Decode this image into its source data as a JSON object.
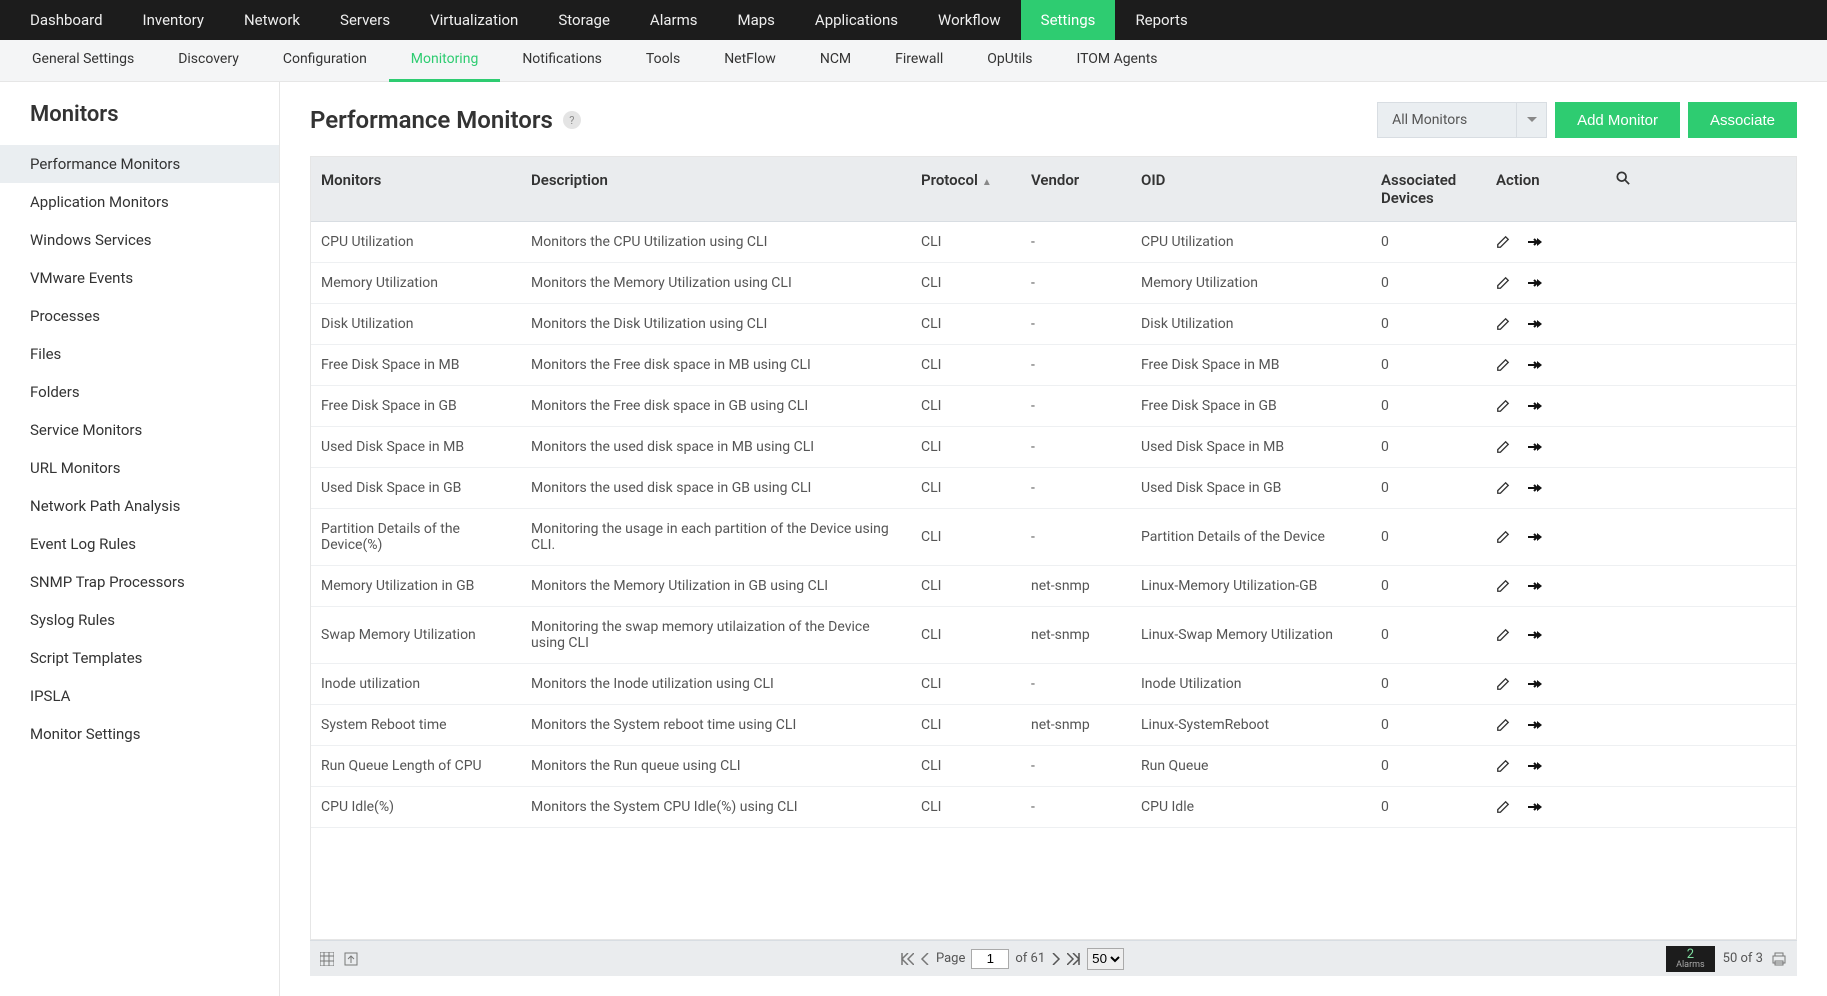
{
  "topnav": [
    "Dashboard",
    "Inventory",
    "Network",
    "Servers",
    "Virtualization",
    "Storage",
    "Alarms",
    "Maps",
    "Applications",
    "Workflow",
    "Settings",
    "Reports"
  ],
  "topnav_active": 10,
  "subnav": [
    "General Settings",
    "Discovery",
    "Configuration",
    "Monitoring",
    "Notifications",
    "Tools",
    "NetFlow",
    "NCM",
    "Firewall",
    "OpUtils",
    "ITOM Agents"
  ],
  "subnav_active": 3,
  "sidebar": {
    "title": "Monitors",
    "items": [
      "Performance Monitors",
      "Application Monitors",
      "Windows Services",
      "VMware Events",
      "Processes",
      "Files",
      "Folders",
      "Service Monitors",
      "URL Monitors",
      "Network Path Analysis",
      "Event Log Rules",
      "SNMP Trap Processors",
      "Syslog Rules",
      "Script Templates",
      "IPSLA",
      "Monitor Settings"
    ],
    "active": 0
  },
  "page": {
    "title": "Performance Monitors",
    "filter_label": "All Monitors",
    "add_btn": "Add Monitor",
    "associate_btn": "Associate"
  },
  "table": {
    "headers": {
      "monitors": "Monitors",
      "description": "Description",
      "protocol": "Protocol",
      "vendor": "Vendor",
      "oid": "OID",
      "associated": "Associated Devices",
      "action": "Action"
    },
    "rows": [
      {
        "m": "CPU Utilization",
        "d": "Monitors the CPU Utilization using CLI",
        "p": "CLI",
        "v": "-",
        "o": "CPU Utilization",
        "a": "0"
      },
      {
        "m": "Memory Utilization",
        "d": "Monitors the Memory Utilization using CLI",
        "p": "CLI",
        "v": "-",
        "o": "Memory Utilization",
        "a": "0"
      },
      {
        "m": "Disk Utilization",
        "d": "Monitors the Disk Utilization using CLI",
        "p": "CLI",
        "v": "-",
        "o": "Disk Utilization",
        "a": "0"
      },
      {
        "m": "Free Disk Space in MB",
        "d": "Monitors the Free disk space in MB using CLI",
        "p": "CLI",
        "v": "-",
        "o": "Free Disk Space in MB",
        "a": "0"
      },
      {
        "m": "Free Disk Space in GB",
        "d": "Monitors the Free disk space in GB using CLI",
        "p": "CLI",
        "v": "-",
        "o": "Free Disk Space in GB",
        "a": "0"
      },
      {
        "m": "Used Disk Space in MB",
        "d": "Monitors the used disk space in MB using CLI",
        "p": "CLI",
        "v": "-",
        "o": "Used Disk Space in MB",
        "a": "0"
      },
      {
        "m": "Used Disk Space in GB",
        "d": "Monitors the used disk space in GB using CLI",
        "p": "CLI",
        "v": "-",
        "o": "Used Disk Space in GB",
        "a": "0"
      },
      {
        "m": "Partition Details of the Device(%)",
        "d": "Monitoring the usage in each partition of the Device using CLI.",
        "p": "CLI",
        "v": "-",
        "o": "Partition Details of the Device",
        "a": "0"
      },
      {
        "m": "Memory Utilization in GB",
        "d": "Monitors the Memory Utilization in GB using CLI",
        "p": "CLI",
        "v": "net-snmp",
        "o": "Linux-Memory Utilization-GB",
        "a": "0"
      },
      {
        "m": "Swap Memory Utilization",
        "d": "Monitoring the swap memory utilaization of the Device using CLI",
        "p": "CLI",
        "v": "net-snmp",
        "o": "Linux-Swap Memory Utilization",
        "a": "0"
      },
      {
        "m": "Inode utilization",
        "d": "Monitors the Inode utilization using CLI",
        "p": "CLI",
        "v": "-",
        "o": "Inode Utilization",
        "a": "0"
      },
      {
        "m": "System Reboot time",
        "d": "Monitors the System reboot time using CLI",
        "p": "CLI",
        "v": "net-snmp",
        "o": "Linux-SystemReboot",
        "a": "0"
      },
      {
        "m": "Run Queue Length of CPU",
        "d": "Monitors the Run queue using CLI",
        "p": "CLI",
        "v": "-",
        "o": "Run Queue",
        "a": "0"
      },
      {
        "m": "CPU Idle(%)",
        "d": "Monitors the System CPU Idle(%) using CLI",
        "p": "CLI",
        "v": "-",
        "o": "CPU Idle",
        "a": "0"
      }
    ]
  },
  "pager": {
    "page_label": "Page",
    "page_value": "1",
    "of_label": "of 61",
    "page_size": "50",
    "page_size_options": [
      "50"
    ],
    "alarm_count": "2",
    "alarm_label": "Alarms",
    "range": "50 of 3"
  }
}
